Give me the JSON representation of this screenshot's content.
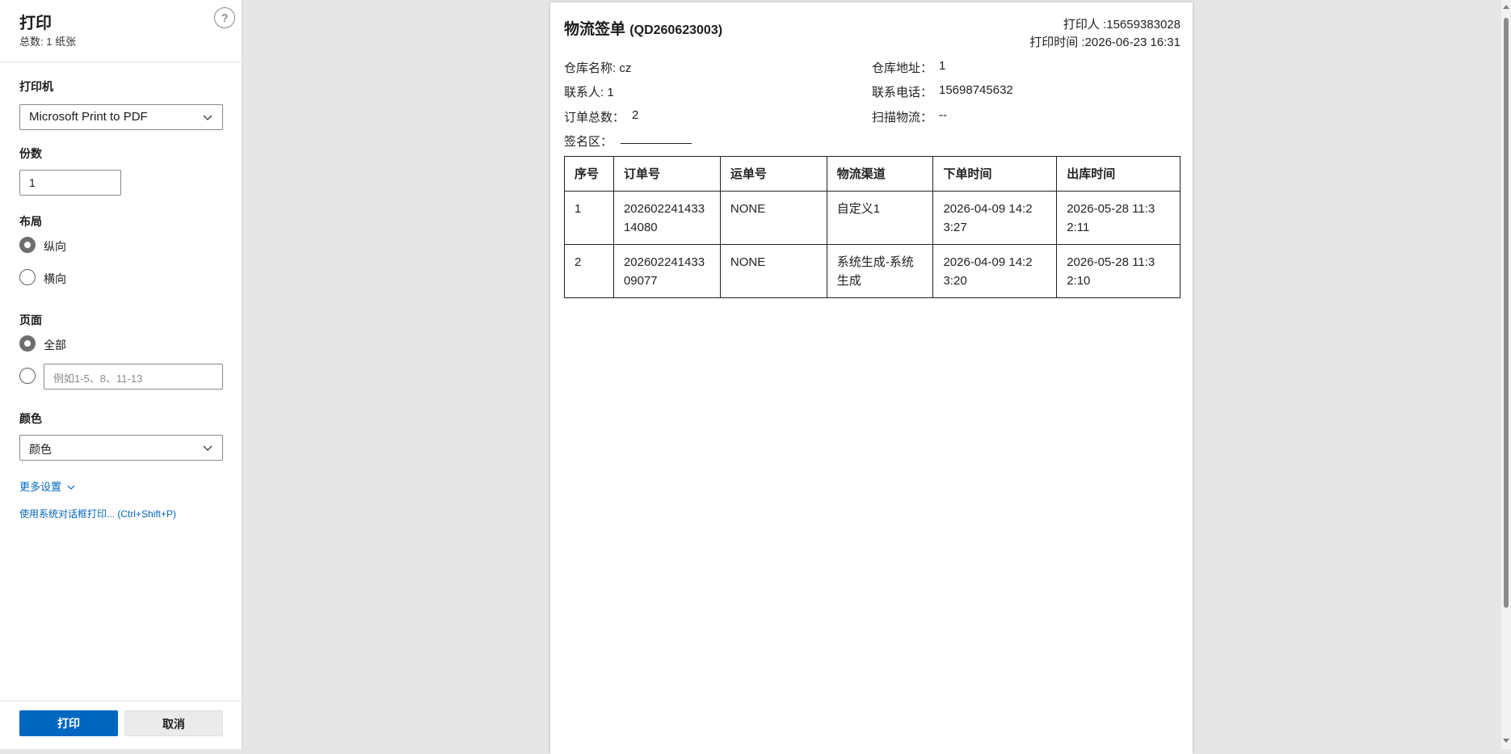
{
  "panel": {
    "title": "打印",
    "subtitle": "总数: 1 纸张",
    "help_glyph": "?",
    "printer": {
      "label": "打印机",
      "value": "Microsoft Print to PDF"
    },
    "copies": {
      "label": "份数",
      "value": "1"
    },
    "layout": {
      "label": "布局",
      "options": [
        "纵向",
        "横向"
      ],
      "selected": "纵向"
    },
    "pages": {
      "label": "页面",
      "all_label": "全部",
      "range_placeholder": "例如1-5、8、11-13",
      "selected": "全部"
    },
    "color": {
      "label": "颜色",
      "value": "颜色"
    },
    "more_settings": "更多设置",
    "system_dialog": "使用系统对话框打印... (Ctrl+Shift+P)",
    "print_button": "打印",
    "cancel_button": "取消",
    "accent_color": "#0067c0"
  },
  "document": {
    "title": "物流签单",
    "code": "(QD260623003)",
    "printer_user": "打印人 :15659383028",
    "print_time": "打印时间 :2026-06-23 16:31",
    "warehouse_name": "仓库名称: cz",
    "warehouse_address_label": "仓库地址：",
    "warehouse_address_value": "1",
    "contact": "联系人: 1",
    "phone_label": "联系电话：",
    "phone_value": "15698745632",
    "order_total_label": "订单总数：",
    "order_total_value": "2",
    "scan_label": "扫描物流：",
    "scan_value": "--",
    "sign_label": "签名区：",
    "table": {
      "headers": [
        "序号",
        "订单号",
        "运单号",
        "物流渠道",
        "下单时间",
        "出库时间"
      ],
      "rows": [
        [
          "1",
          "202602241433 14080",
          "NONE",
          "自定义1",
          "2026-04-09 14:2 3:27",
          "2026-05-28 11:3 2:11"
        ],
        [
          "2",
          "202602241433 09077",
          "NONE",
          "系统生成-系统 生成",
          "2026-04-09 14:2 3:20",
          "2026-05-28 11:3 2:10"
        ]
      ]
    }
  }
}
